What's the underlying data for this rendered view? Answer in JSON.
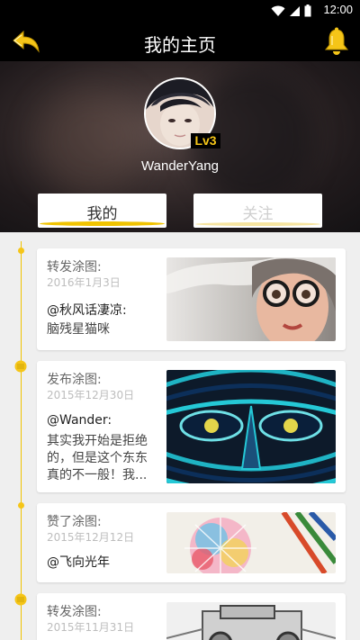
{
  "status_bar": {
    "time": "12:00"
  },
  "header": {
    "title": "我的主页",
    "username": "WanderYang",
    "level": "Lv3"
  },
  "tabs": [
    {
      "label": "我的",
      "active": true
    },
    {
      "label": "关注",
      "active": false
    }
  ],
  "feed": [
    {
      "action": "转发涂图:",
      "date": "2016年1月3日",
      "user": "@秋风话凄凉:",
      "text": "脑残星猫咪",
      "image": "portrait-girl-glasses"
    },
    {
      "action": "发布涂图:",
      "date": "2015年12月30日",
      "user": "@Wander:",
      "text": "其实我开始是拒绝的，但是这个东东真的不一般！我...",
      "image": "abstract-face-teal"
    },
    {
      "action": "赞了涂图:",
      "date": "2015年12月12日",
      "user": "@飞向光年",
      "text": "",
      "image": "watercolor-pencils"
    },
    {
      "action": "转发涂图:",
      "date": "2015年11月31日",
      "user": "",
      "text": "",
      "image": "sketch-vehicle"
    }
  ],
  "colors": {
    "accent": "#f5c518",
    "bar": "#000000",
    "background": "#efefef"
  },
  "icons": {
    "back": "back-arrow-icon",
    "bell": "bell-icon",
    "wifi": "wifi-icon",
    "signal": "signal-icon",
    "battery": "battery-icon"
  }
}
